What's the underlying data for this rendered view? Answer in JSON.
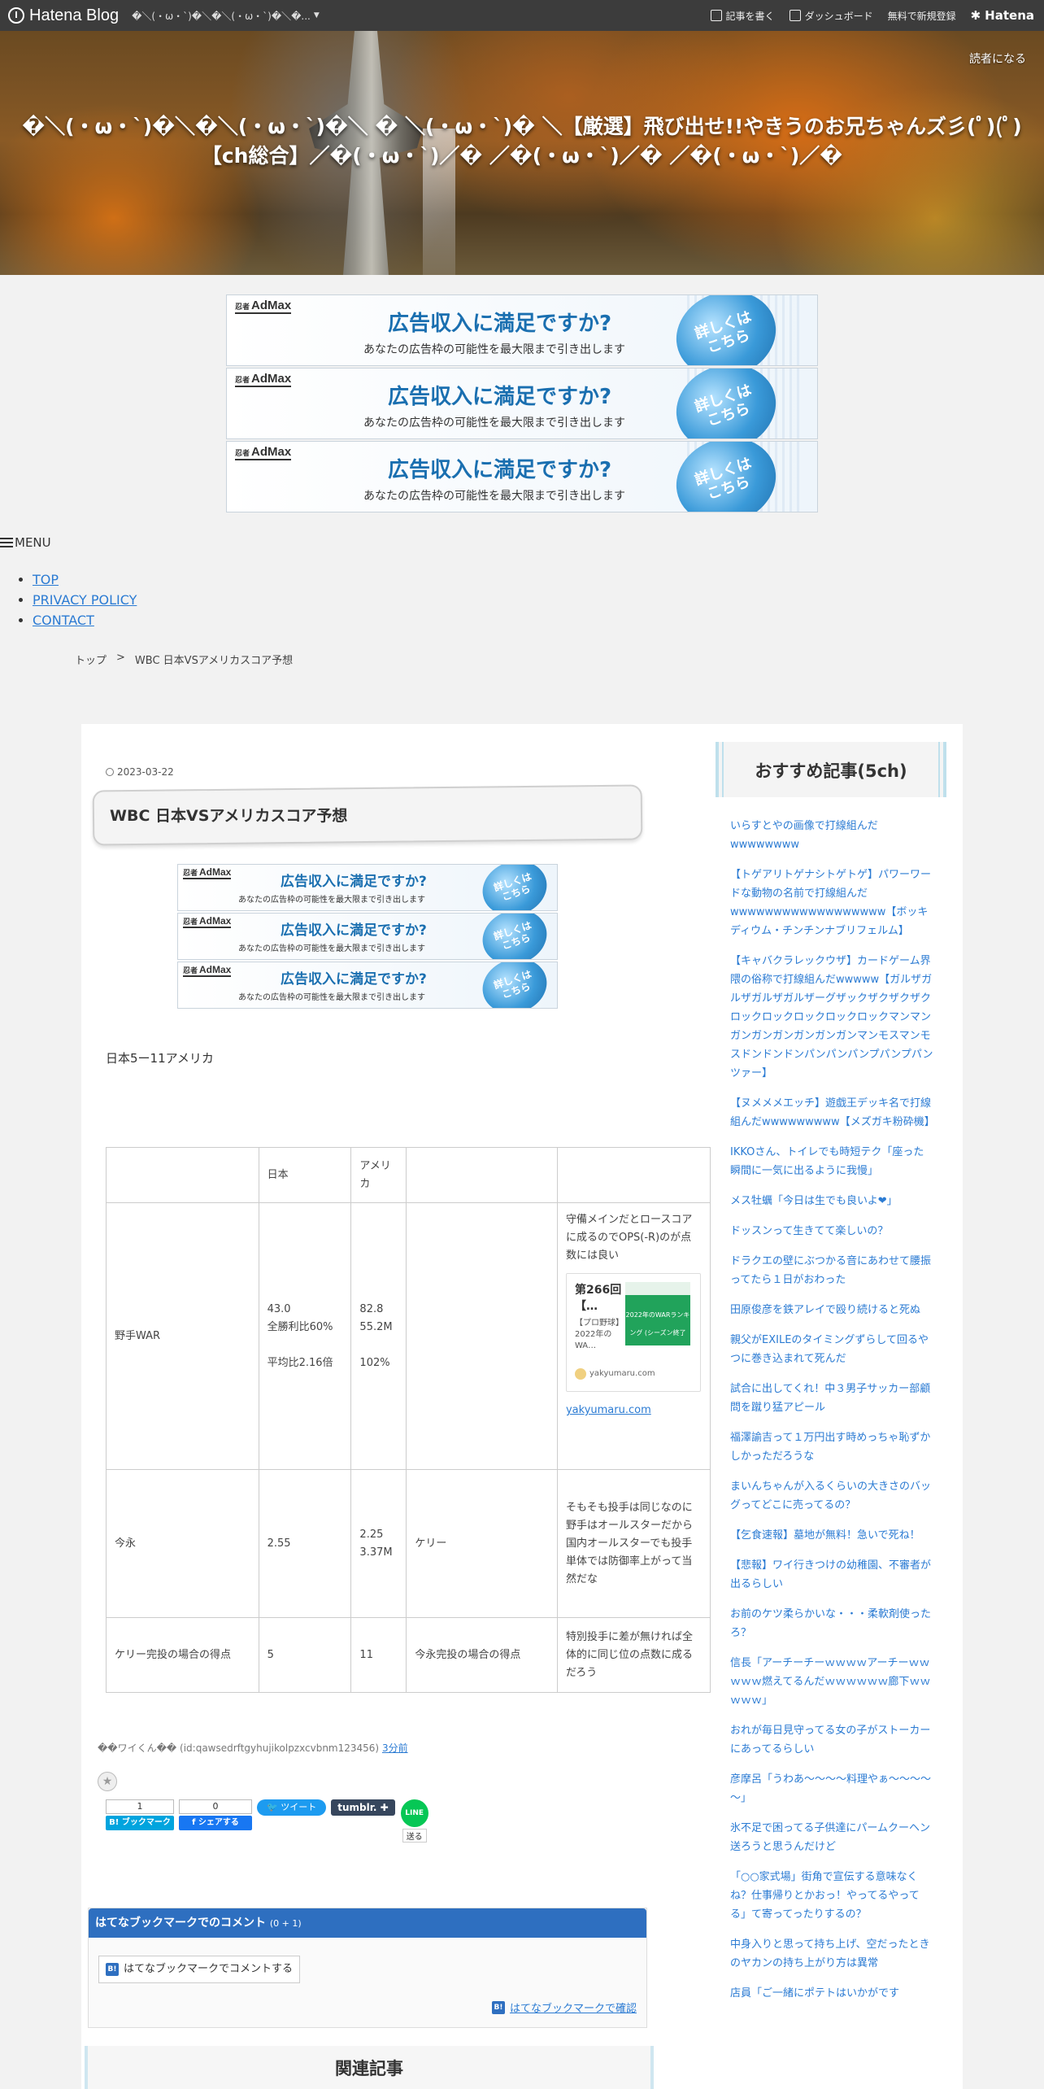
{
  "globalbar": {
    "logo": "Hatena Blog",
    "blog_name": "�＼(・ω・`)�＼�＼(・ω・`)�＼�...",
    "write": "記事を書く",
    "dashboard": "ダッシュボード",
    "signup": "無料で新規登録",
    "hatena": "Hatena"
  },
  "header": {
    "reader": "読者になる",
    "title": "�＼(・ω・`)�＼�＼(・ω・`)�＼ � ＼(・ω・`)� ＼【厳選】飛び出せ!!やきうのお兄ちゃんズ彡(ﾟ)(ﾟ)【ch総合】／�(・ω・`)／� ／�(・ω・`)／� ／�(・ω・`)／�"
  },
  "ad": {
    "logo_sub": "忍者",
    "logo_main": "AdMax",
    "headline": "広告収入に満足ですか?",
    "body": "あなたの広告枠の可能性を最大限まで引き出します",
    "circle_line1": "詳しくは",
    "circle_line2": "こちら"
  },
  "menu": {
    "label": "MENU",
    "items": [
      "TOP",
      "PRIVACY POLICY",
      "CONTACT"
    ]
  },
  "breadcrumb": {
    "home": "トップ",
    "sep": ">",
    "current": "WBC 日本VSアメリカスコア予想"
  },
  "post": {
    "date": "2023-03-22",
    "title": "WBC 日本VSアメリカスコア予想",
    "body": "日本5ー11アメリカ",
    "table": {
      "header": [
        "",
        "日本",
        "アメリカ",
        "",
        ""
      ],
      "row1": {
        "label": "野手WAR",
        "japan": [
          "43.0",
          "全勝利比60%",
          "",
          "平均比2.16倍"
        ],
        "usa": [
          "82.8",
          "55.2M",
          "",
          "102%"
        ],
        "note": "守備メインだとロースコアに成るのでOPS(-R)のが点数には良い",
        "card_title": "第266回 【…",
        "card_sub": "【プロ野球】2022年のWA…",
        "card_img": "2022年のWARランキング (シーズン終了版)",
        "card_site": "yakyumaru.com",
        "link": "yakyumaru.com"
      },
      "row2": {
        "label": "今永",
        "japan": "2.55",
        "usa": [
          "2.25",
          "3.37M"
        ],
        "opp": "ケリー",
        "note": "そもそも投手は同じなのに野手はオールスターだから国内オールスターでも投手単体では防御率上がって当然だな"
      },
      "row3": {
        "label": "ケリー完投の場合の得点",
        "japan": "5",
        "usa": "11",
        "opp": "今永完投の場合の得点",
        "note": "特別投手に差が無ければ全体的に同じ位の点数に成るだろう"
      }
    },
    "author": "��ワイくん�� (id:qawsedrftgyhujikolpzxcvbnm123456)",
    "time_ago": "3分前"
  },
  "share": {
    "hatebu_count": "1",
    "hatebu_label": "B! ブックマーク",
    "fb_count": "0",
    "fb_label": "f シェアする",
    "tweet": "ツイート",
    "tumblr": "tumblr. ✚",
    "line": "LINE",
    "line_send": "送る"
  },
  "comments": {
    "title": "はてなブックマークでのコメント",
    "count": "(0 + 1)",
    "button": "はてなブックマークでコメントする",
    "confirm": "はてなブックマークで確認"
  },
  "related": {
    "title": "関連記事"
  },
  "sidebar": {
    "title": "おすすめ記事(5ch)",
    "items": [
      "いらすとやの画像で打線組んだwwwwwwww",
      "【トゲアリトゲナシトゲトゲ】パワーワードな動物の名前で打線組んだwwwwwwwwwwwwwwwwww【ボッキディウム・チンチンナブリフェルム】",
      "【キャバクラレックウザ】カードゲーム界隈の俗称で打線組んだwwwww【ガルザガルザガルザガルザーグザックザクザクザクロックロックロックロックロックマンマンガンガンガンガンガンガンマンモスマンモスドンドンドンパンパンパンプパンプパンツァー】",
      "【ヌメメメエッチ】遊戯王デッキ名で打線組んだwwwwwwwww【メズガキ粉砕機】",
      "IKKOさん、トイレでも時短テク「座った瞬間に一気に出るように我慢」",
      "メス牡蠣「今日は生でも良いよ❤」",
      "ドッスンって生きてて楽しいの？",
      "ドラクエの壁にぶつかる音にあわせて腰振ってたら１日がおわった",
      "田原俊彦を鉄アレイで殴り続けると死ぬ",
      "親父がEXILEのタイミングずらして回るやつに巻き込まれて死んだ",
      "試合に出してくれ！中３男子サッカー部顧問を蹴り猛アピール",
      "福澤諭吉って１万円出す時めっちゃ恥ずかしかっただろうな",
      "まいんちゃんが入るくらいの大きさのバッグってどこに売ってるの？",
      "【乞食速報】墓地が無料！急いで死ね！",
      "【悲報】ワイ行きつけの幼稚園、不審者が出るらしい",
      "お前のケツ柔らかいな・・・柔軟剤使ったろ？",
      "信長「アーチーチーｗｗｗｗアーチーｗｗｗｗｗ燃えてるんだｗｗｗｗｗｗ廊下ｗｗｗｗｗ」",
      "おれが毎日見守ってる女の子がストーカーにあってるらしい",
      "彦摩呂「うわあ～～～～料理やぁ～～～～～」",
      "氷不足で困ってる子供達にパームクーヘン送ろうと思うんだけど",
      "「○○家式場」街角で宣伝する意味なくね？仕事帰りとかおっ！やってるやってる」て寄ってったりするの？",
      "中身入りと思って持ち上げ、空だったときのヤカンの持ち上がり方は異常",
      "店員「ご一緒にポテトはいかがです"
    ]
  }
}
